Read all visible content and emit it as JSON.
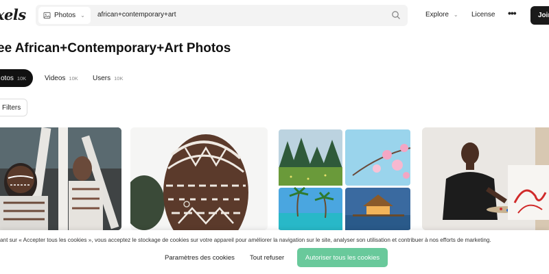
{
  "header": {
    "logo": "xels",
    "media_type": "Photos",
    "search_value": "african+contemporary+art",
    "nav_explore": "Explore",
    "nav_license": "License",
    "nav_more": "•••",
    "join_label": "Join"
  },
  "page_title": "ee African+Contemporary+Art Photos",
  "tabs": [
    {
      "label": "otos",
      "count": "10K"
    },
    {
      "label": "Videos",
      "count": "10K"
    },
    {
      "label": "Users",
      "count": "10K"
    }
  ],
  "filters_label": "Filters",
  "cookie": {
    "text": "ant sur « Accepter tous les cookies », vous acceptez le stockage de cookies sur votre appareil pour améliorer la navigation sur le site, analyser son utilisation et contribuer à nos efforts de marketing.",
    "settings_label": "Paramètres des cookies",
    "refuse_label": "Tout refuser",
    "accept_label": "Autoriser tous les cookies"
  },
  "colors": {
    "accent_green": "#69c99b",
    "dark": "#111111"
  }
}
